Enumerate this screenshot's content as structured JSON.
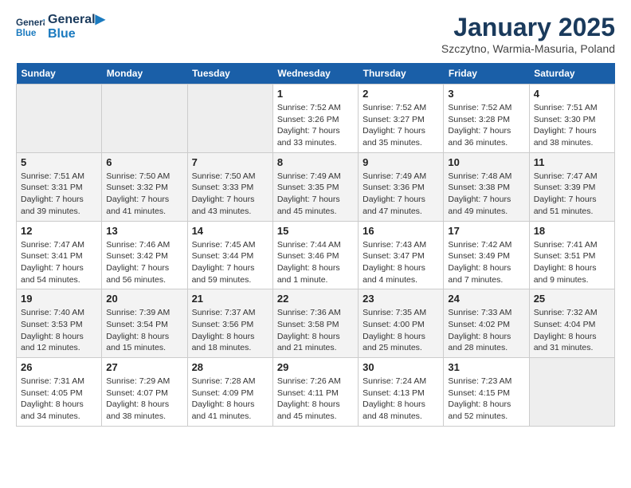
{
  "logo": {
    "line1": "General",
    "line2": "Blue"
  },
  "title": "January 2025",
  "subtitle": "Szczytno, Warmia-Masuria, Poland",
  "weekdays": [
    "Sunday",
    "Monday",
    "Tuesday",
    "Wednesday",
    "Thursday",
    "Friday",
    "Saturday"
  ],
  "weeks": [
    [
      {
        "day": "",
        "info": ""
      },
      {
        "day": "",
        "info": ""
      },
      {
        "day": "",
        "info": ""
      },
      {
        "day": "1",
        "info": "Sunrise: 7:52 AM\nSunset: 3:26 PM\nDaylight: 7 hours and 33 minutes."
      },
      {
        "day": "2",
        "info": "Sunrise: 7:52 AM\nSunset: 3:27 PM\nDaylight: 7 hours and 35 minutes."
      },
      {
        "day": "3",
        "info": "Sunrise: 7:52 AM\nSunset: 3:28 PM\nDaylight: 7 hours and 36 minutes."
      },
      {
        "day": "4",
        "info": "Sunrise: 7:51 AM\nSunset: 3:30 PM\nDaylight: 7 hours and 38 minutes."
      }
    ],
    [
      {
        "day": "5",
        "info": "Sunrise: 7:51 AM\nSunset: 3:31 PM\nDaylight: 7 hours and 39 minutes."
      },
      {
        "day": "6",
        "info": "Sunrise: 7:50 AM\nSunset: 3:32 PM\nDaylight: 7 hours and 41 minutes."
      },
      {
        "day": "7",
        "info": "Sunrise: 7:50 AM\nSunset: 3:33 PM\nDaylight: 7 hours and 43 minutes."
      },
      {
        "day": "8",
        "info": "Sunrise: 7:49 AM\nSunset: 3:35 PM\nDaylight: 7 hours and 45 minutes."
      },
      {
        "day": "9",
        "info": "Sunrise: 7:49 AM\nSunset: 3:36 PM\nDaylight: 7 hours and 47 minutes."
      },
      {
        "day": "10",
        "info": "Sunrise: 7:48 AM\nSunset: 3:38 PM\nDaylight: 7 hours and 49 minutes."
      },
      {
        "day": "11",
        "info": "Sunrise: 7:47 AM\nSunset: 3:39 PM\nDaylight: 7 hours and 51 minutes."
      }
    ],
    [
      {
        "day": "12",
        "info": "Sunrise: 7:47 AM\nSunset: 3:41 PM\nDaylight: 7 hours and 54 minutes."
      },
      {
        "day": "13",
        "info": "Sunrise: 7:46 AM\nSunset: 3:42 PM\nDaylight: 7 hours and 56 minutes."
      },
      {
        "day": "14",
        "info": "Sunrise: 7:45 AM\nSunset: 3:44 PM\nDaylight: 7 hours and 59 minutes."
      },
      {
        "day": "15",
        "info": "Sunrise: 7:44 AM\nSunset: 3:46 PM\nDaylight: 8 hours and 1 minute."
      },
      {
        "day": "16",
        "info": "Sunrise: 7:43 AM\nSunset: 3:47 PM\nDaylight: 8 hours and 4 minutes."
      },
      {
        "day": "17",
        "info": "Sunrise: 7:42 AM\nSunset: 3:49 PM\nDaylight: 8 hours and 7 minutes."
      },
      {
        "day": "18",
        "info": "Sunrise: 7:41 AM\nSunset: 3:51 PM\nDaylight: 8 hours and 9 minutes."
      }
    ],
    [
      {
        "day": "19",
        "info": "Sunrise: 7:40 AM\nSunset: 3:53 PM\nDaylight: 8 hours and 12 minutes."
      },
      {
        "day": "20",
        "info": "Sunrise: 7:39 AM\nSunset: 3:54 PM\nDaylight: 8 hours and 15 minutes."
      },
      {
        "day": "21",
        "info": "Sunrise: 7:37 AM\nSunset: 3:56 PM\nDaylight: 8 hours and 18 minutes."
      },
      {
        "day": "22",
        "info": "Sunrise: 7:36 AM\nSunset: 3:58 PM\nDaylight: 8 hours and 21 minutes."
      },
      {
        "day": "23",
        "info": "Sunrise: 7:35 AM\nSunset: 4:00 PM\nDaylight: 8 hours and 25 minutes."
      },
      {
        "day": "24",
        "info": "Sunrise: 7:33 AM\nSunset: 4:02 PM\nDaylight: 8 hours and 28 minutes."
      },
      {
        "day": "25",
        "info": "Sunrise: 7:32 AM\nSunset: 4:04 PM\nDaylight: 8 hours and 31 minutes."
      }
    ],
    [
      {
        "day": "26",
        "info": "Sunrise: 7:31 AM\nSunset: 4:05 PM\nDaylight: 8 hours and 34 minutes."
      },
      {
        "day": "27",
        "info": "Sunrise: 7:29 AM\nSunset: 4:07 PM\nDaylight: 8 hours and 38 minutes."
      },
      {
        "day": "28",
        "info": "Sunrise: 7:28 AM\nSunset: 4:09 PM\nDaylight: 8 hours and 41 minutes."
      },
      {
        "day": "29",
        "info": "Sunrise: 7:26 AM\nSunset: 4:11 PM\nDaylight: 8 hours and 45 minutes."
      },
      {
        "day": "30",
        "info": "Sunrise: 7:24 AM\nSunset: 4:13 PM\nDaylight: 8 hours and 48 minutes."
      },
      {
        "day": "31",
        "info": "Sunrise: 7:23 AM\nSunset: 4:15 PM\nDaylight: 8 hours and 52 minutes."
      },
      {
        "day": "",
        "info": ""
      }
    ]
  ]
}
